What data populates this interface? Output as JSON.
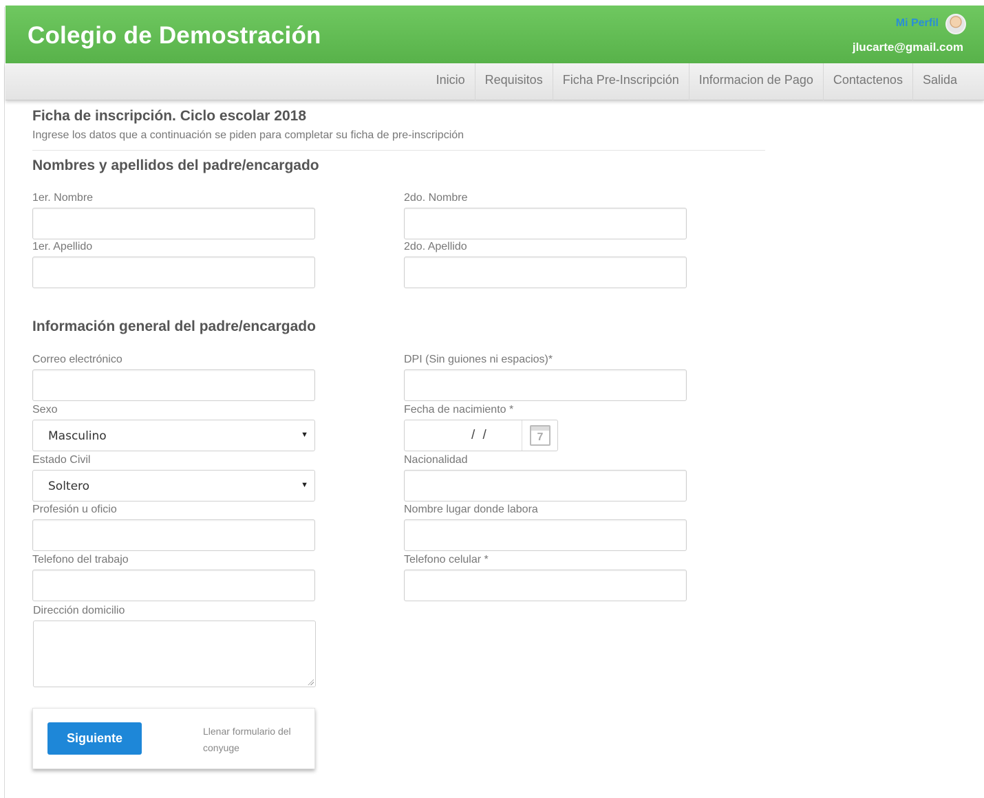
{
  "header": {
    "brand": "Colegio de Demostración",
    "profile_label": "Mi Perfil",
    "user_email": "jlucarte@gmail.com"
  },
  "nav": {
    "items": [
      "Inicio",
      "Requisitos",
      "Ficha Pre-Inscripción",
      "Informacion de Pago",
      "Contactenos",
      "Salida"
    ]
  },
  "page": {
    "title": "Ficha de inscripción. Ciclo escolar 2018",
    "subtitle": "Ingrese los datos que a continuación se piden para completar su ficha de pre-inscripción"
  },
  "names_section": {
    "title": "Nombres y apellidos del padre/encargado",
    "first_name_label": "1er. Nombre",
    "second_name_label": "2do. Nombre",
    "first_surname_label": "1er. Apellido",
    "second_surname_label": "2do. Apellido"
  },
  "general_section": {
    "title": "Información general del padre/encargado",
    "email_label": "Correo electrónico",
    "dpi_label": "DPI (Sin guiones ni espacios)*",
    "sex_label": "Sexo",
    "sex_value": "Masculino",
    "birthdate_label": "Fecha de nacimiento *",
    "birthdate_value": "/ /",
    "calendar_day": "7",
    "civil_status_label": "Estado Civil",
    "civil_status_value": "Soltero",
    "nationality_label": "Nacionalidad",
    "profession_label": "Profesión u oficio",
    "workplace_label": "Nombre lugar donde labora",
    "work_phone_label": "Telefono del trabajo",
    "mobile_phone_label": "Telefono celular *",
    "address_label": "Dirección domicilio"
  },
  "actions": {
    "next_label": "Siguiente",
    "spouse_link": "Llenar formulario del conyuge"
  }
}
